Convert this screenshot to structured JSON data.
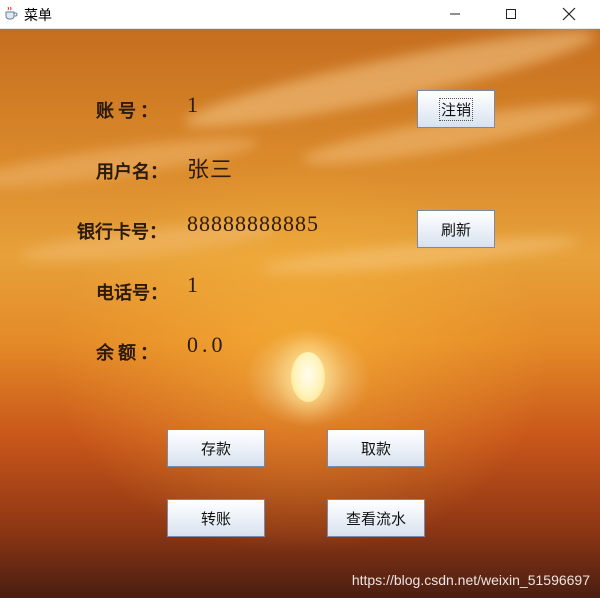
{
  "window": {
    "title": "菜单",
    "app_icon": "java-cup-icon",
    "controls": {
      "minimize": "minimize-icon",
      "maximize": "maximize-icon",
      "close": "close-icon"
    }
  },
  "account": {
    "fields": [
      {
        "label": "账号：",
        "value": "1"
      },
      {
        "label": "用户名：",
        "value": "张三"
      },
      {
        "label": "银行卡号：",
        "value": "88888888885"
      },
      {
        "label": "电话号：",
        "value": "1"
      },
      {
        "label": "余额：",
        "value": "0.0"
      }
    ]
  },
  "buttons": {
    "logout": "注销",
    "refresh": "刷新",
    "deposit": "存款",
    "withdraw": "取款",
    "transfer": "转账",
    "view_history": "查看流水"
  },
  "watermark": "https://blog.csdn.net/weixin_51596697"
}
